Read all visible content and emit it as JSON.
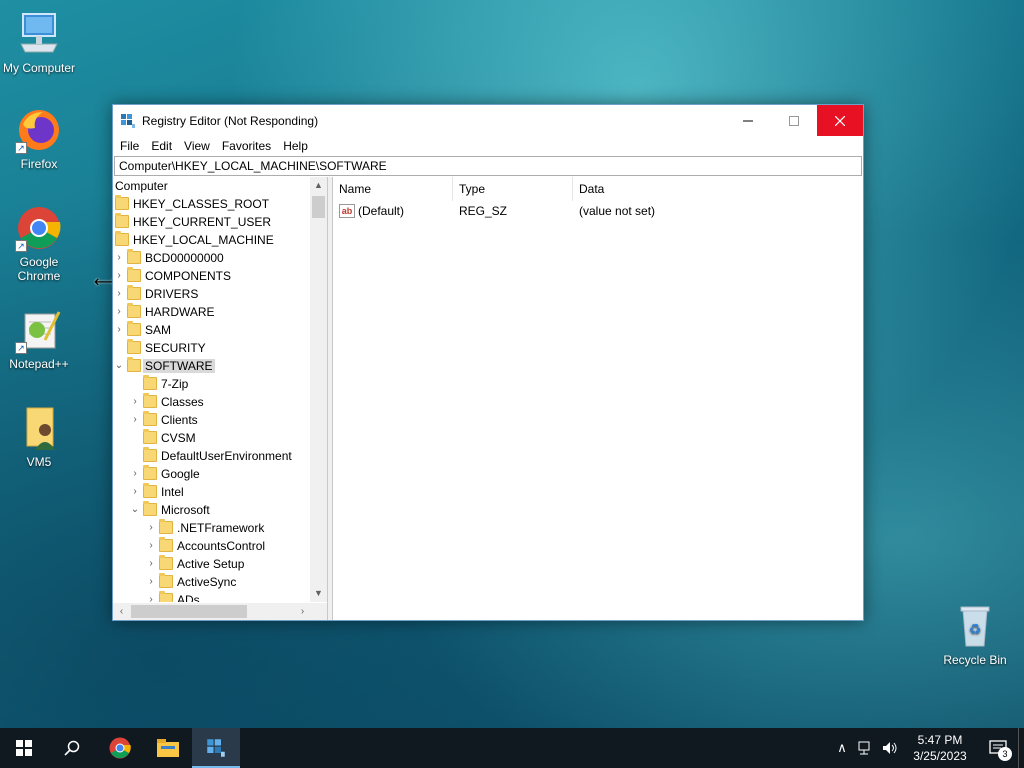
{
  "desktop": {
    "icons": [
      {
        "label": "My Computer"
      },
      {
        "label": "Firefox"
      },
      {
        "label": "Google Chrome"
      },
      {
        "label": "Notepad++"
      },
      {
        "label": "VM5"
      },
      {
        "label": "Recycle Bin"
      }
    ]
  },
  "window": {
    "title": "Registry Editor (Not Responding)",
    "menu": [
      "File",
      "Edit",
      "View",
      "Favorites",
      "Help"
    ],
    "address": "Computer\\HKEY_LOCAL_MACHINE\\SOFTWARE",
    "tree": [
      {
        "label": "Computer",
        "level": 0,
        "expander": "none",
        "folder": false
      },
      {
        "label": "HKEY_CLASSES_ROOT",
        "level": 0,
        "expander": "none",
        "folder": true
      },
      {
        "label": "HKEY_CURRENT_USER",
        "level": 0,
        "expander": "none",
        "folder": true
      },
      {
        "label": "HKEY_LOCAL_MACHINE",
        "level": 0,
        "expander": "none",
        "folder": true
      },
      {
        "label": "BCD00000000",
        "level": 1,
        "expander": "collapsed",
        "folder": true
      },
      {
        "label": "COMPONENTS",
        "level": 1,
        "expander": "collapsed",
        "folder": true
      },
      {
        "label": "DRIVERS",
        "level": 1,
        "expander": "collapsed",
        "folder": true
      },
      {
        "label": "HARDWARE",
        "level": 1,
        "expander": "collapsed",
        "folder": true
      },
      {
        "label": "SAM",
        "level": 1,
        "expander": "collapsed",
        "folder": true
      },
      {
        "label": "SECURITY",
        "level": 1,
        "expander": "none",
        "folder": true
      },
      {
        "label": "SOFTWARE",
        "level": 1,
        "expander": "expanded",
        "folder": true,
        "selected": true
      },
      {
        "label": "7-Zip",
        "level": 2,
        "expander": "none",
        "folder": true
      },
      {
        "label": "Classes",
        "level": 2,
        "expander": "collapsed",
        "folder": true
      },
      {
        "label": "Clients",
        "level": 2,
        "expander": "collapsed",
        "folder": true
      },
      {
        "label": "CVSM",
        "level": 2,
        "expander": "none",
        "folder": true
      },
      {
        "label": "DefaultUserEnvironment",
        "level": 2,
        "expander": "none",
        "folder": true
      },
      {
        "label": "Google",
        "level": 2,
        "expander": "collapsed",
        "folder": true
      },
      {
        "label": "Intel",
        "level": 2,
        "expander": "collapsed",
        "folder": true
      },
      {
        "label": "Microsoft",
        "level": 2,
        "expander": "expanded",
        "folder": true
      },
      {
        "label": ".NETFramework",
        "level": 3,
        "expander": "collapsed",
        "folder": true
      },
      {
        "label": "AccountsControl",
        "level": 3,
        "expander": "collapsed",
        "folder": true
      },
      {
        "label": "Active Setup",
        "level": 3,
        "expander": "collapsed",
        "folder": true
      },
      {
        "label": "ActiveSync",
        "level": 3,
        "expander": "collapsed",
        "folder": true
      },
      {
        "label": "ADs",
        "level": 3,
        "expander": "collapsed",
        "folder": true
      }
    ],
    "columns": [
      "Name",
      "Type",
      "Data"
    ],
    "values": [
      {
        "name": "(Default)",
        "type": "REG_SZ",
        "data": "(value not set)",
        "icon": "string-value-icon"
      }
    ]
  },
  "taskbar": {
    "time": "5:47 PM",
    "date": "3/25/2023",
    "notification_count": "3"
  },
  "colors": {
    "close_button": "#e81123",
    "selection": "#d9d9d9",
    "taskbar": "#101820"
  }
}
